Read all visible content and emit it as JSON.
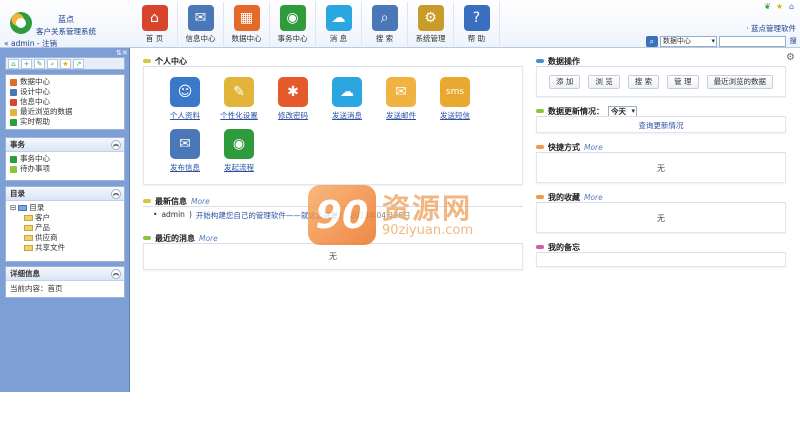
{
  "app": {
    "logo_name": "蓝点",
    "logo_subtitle": "客户关系管理系统",
    "user": "admin",
    "logout": "注销",
    "system_name": "· 蓝点管理软件"
  },
  "nav": [
    {
      "label": "首 页",
      "icon": "home-icon",
      "color": "#d9442e",
      "glyph": "⌂"
    },
    {
      "label": "信息中心",
      "icon": "info-center-icon",
      "color": "#4a77b8",
      "glyph": "✉"
    },
    {
      "label": "数据中心",
      "icon": "data-center-icon",
      "color": "#e56a2a",
      "glyph": "▦"
    },
    {
      "label": "事务中心",
      "icon": "affairs-icon",
      "color": "#2e9b3c",
      "glyph": "◉"
    },
    {
      "label": "消 息",
      "icon": "message-icon",
      "color": "#2aa7e0",
      "glyph": "☁"
    },
    {
      "label": "搜 索",
      "icon": "search-icon",
      "color": "#4a77b8",
      "glyph": "⌕"
    },
    {
      "label": "系统管理",
      "icon": "system-admin-icon",
      "color": "#c99b2a",
      "glyph": "⚙"
    },
    {
      "label": "帮 助",
      "icon": "help-icon",
      "color": "#3a6fc0",
      "glyph": "?"
    }
  ],
  "search": {
    "scope": "数据中心",
    "button": "搜"
  },
  "sidebar": {
    "quick_items": [
      "数据中心",
      "设计中心",
      "信息中心",
      "最近浏览的数据",
      "实时帮助"
    ],
    "affairs_title": "事务",
    "affairs_items": [
      "事务中心",
      "待办事项"
    ],
    "catalog_title": "目录",
    "catalog_root": "目录",
    "catalog_items": [
      "客户",
      "产品",
      "供应商",
      "共享文件"
    ],
    "details_title": "详细信息",
    "details_text": "当前内容：首页"
  },
  "personal": {
    "title": "个人中心",
    "items": [
      {
        "label": "个人资料",
        "icon": "profile-icon",
        "color": "#3b78c9",
        "glyph": "☺"
      },
      {
        "label": "个性化设置",
        "icon": "personalize-icon",
        "color": "#e2b53a",
        "glyph": "✎"
      },
      {
        "label": "修改密码",
        "icon": "password-icon",
        "color": "#e55a2a",
        "glyph": "✱"
      },
      {
        "label": "发送消息",
        "icon": "send-message-icon",
        "color": "#2aa7e0",
        "glyph": "☁"
      },
      {
        "label": "发送邮件",
        "icon": "send-mail-icon",
        "color": "#f0b341",
        "glyph": "✉"
      },
      {
        "label": "发送短信",
        "icon": "send-sms-icon",
        "color": "#e9a830",
        "glyph": "sms"
      },
      {
        "label": "发布信息",
        "icon": "publish-info-icon",
        "color": "#4a77b8",
        "glyph": "✉"
      },
      {
        "label": "发起流程",
        "icon": "start-flow-icon",
        "color": "#2e9b3c",
        "glyph": "◉"
      }
    ]
  },
  "latest_info": {
    "title": "最新信息",
    "more": "More",
    "author": "admin",
    "text": "开始构建您自己的管理软件——就这么简单！",
    "date": "2013年04月28日"
  },
  "recent_messages": {
    "title": "最近的消息",
    "more": "More",
    "empty": "无"
  },
  "data_ops": {
    "title": "数据操作",
    "buttons": [
      "添 加",
      "浏 览",
      "搜 索",
      "管 理",
      "最近浏览的数据"
    ]
  },
  "data_updates": {
    "title": "数据更新情况：",
    "period": "今天",
    "link": "查询更新情况"
  },
  "shortcuts": {
    "title": "快捷方式",
    "more": "More",
    "empty": "无"
  },
  "favorites": {
    "title": "我的收藏",
    "more": "More",
    "empty": "无"
  },
  "memo": {
    "title": "我的备忘"
  },
  "watermark": {
    "main": "资源网",
    "num": "90",
    "url": "90ziyuan.com"
  }
}
